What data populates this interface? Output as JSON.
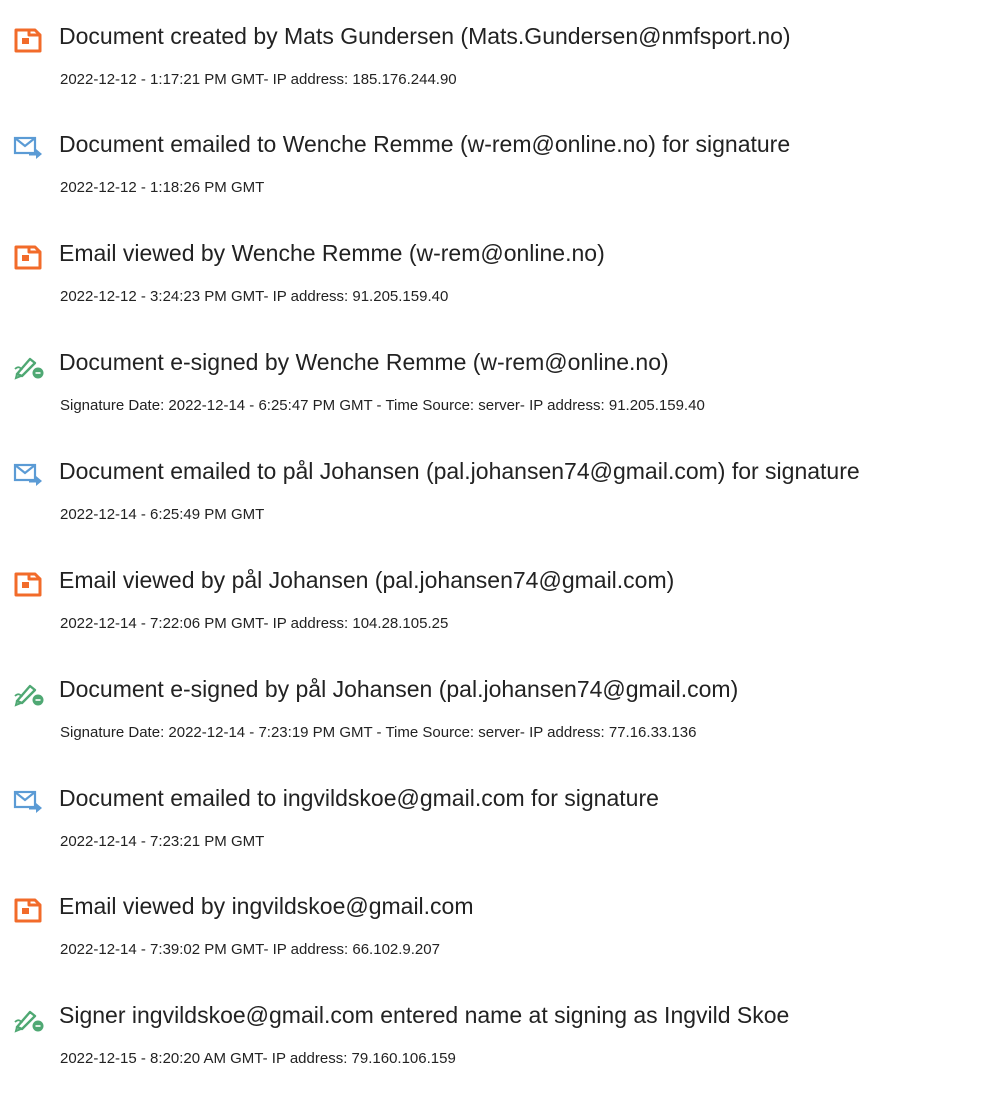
{
  "colors": {
    "doc_icon": "#f26b2a",
    "email_icon": "#5b9bd5",
    "sign_icon": "#4fa873",
    "text": "#222222"
  },
  "entries": [
    {
      "icon": "document-icon",
      "title": "Document created by Mats Gundersen (Mats.Gundersen@nmfsport.no)",
      "detail": "2022-12-12 - 1:17:21 PM GMT- IP address: 185.176.244.90"
    },
    {
      "icon": "email-sent-icon",
      "title": "Document emailed to Wenche Remme (w-rem@online.no) for signature",
      "detail": "2022-12-12 - 1:18:26 PM GMT"
    },
    {
      "icon": "document-icon",
      "title": "Email viewed by Wenche Remme (w-rem@online.no)",
      "detail": "2022-12-12 - 3:24:23 PM GMT- IP address: 91.205.159.40"
    },
    {
      "icon": "signature-pen-icon",
      "title": "Document e-signed by Wenche Remme (w-rem@online.no)",
      "detail": "Signature Date: 2022-12-14 - 6:25:47 PM GMT - Time Source: server- IP address: 91.205.159.40"
    },
    {
      "icon": "email-sent-icon",
      "title": "Document emailed to pål Johansen (pal.johansen74@gmail.com) for signature",
      "detail": "2022-12-14 - 6:25:49 PM GMT"
    },
    {
      "icon": "document-icon",
      "title": "Email viewed by pål Johansen (pal.johansen74@gmail.com)",
      "detail": "2022-12-14 - 7:22:06 PM GMT- IP address: 104.28.105.25"
    },
    {
      "icon": "signature-pen-icon",
      "title": "Document e-signed by pål Johansen (pal.johansen74@gmail.com)",
      "detail": "Signature Date: 2022-12-14 - 7:23:19 PM GMT - Time Source: server- IP address: 77.16.33.136"
    },
    {
      "icon": "email-sent-icon",
      "title": "Document emailed to ingvildskoe@gmail.com for signature",
      "detail": "2022-12-14 - 7:23:21 PM GMT"
    },
    {
      "icon": "document-icon",
      "title": "Email viewed by ingvildskoe@gmail.com",
      "detail": "2022-12-14 - 7:39:02 PM GMT- IP address: 66.102.9.207"
    },
    {
      "icon": "signature-pen-icon",
      "title": "Signer ingvildskoe@gmail.com entered name at signing as Ingvild Skoe",
      "detail": "2022-12-15 - 8:20:20 AM GMT- IP address: 79.160.106.159"
    }
  ]
}
